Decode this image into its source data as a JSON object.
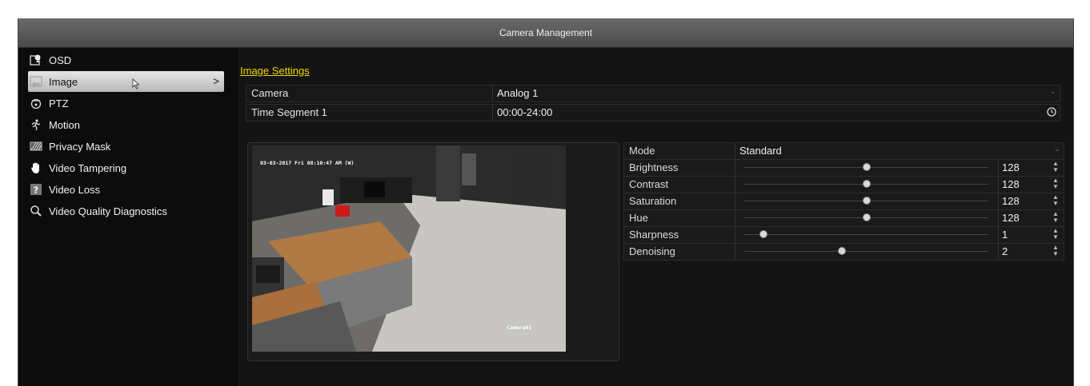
{
  "window": {
    "title": "Camera Management"
  },
  "sidebar": {
    "items": [
      {
        "label": "OSD",
        "icon": "osd-icon"
      },
      {
        "label": "Image",
        "icon": "image-icon",
        "active": true
      },
      {
        "label": "PTZ",
        "icon": "ptz-icon"
      },
      {
        "label": "Motion",
        "icon": "motion-icon"
      },
      {
        "label": "Privacy Mask",
        "icon": "privacy-mask-icon"
      },
      {
        "label": "Video Tampering",
        "icon": "hand-icon"
      },
      {
        "label": "Video Loss",
        "icon": "question-icon"
      },
      {
        "label": "Video Quality Diagnostics",
        "icon": "magnifier-icon"
      }
    ],
    "active_chevron": ">"
  },
  "main": {
    "section_title": "Image Settings",
    "camera": {
      "label": "Camera",
      "value": "Analog 1"
    },
    "time_segment": {
      "label": "Time Segment 1",
      "value": "00:00-24:00"
    },
    "preview": {
      "osd_timestamp": "03-03-2017 Fri 08:10:47 AM (W)",
      "osd_camera_name": "Camera01"
    },
    "mode": {
      "label": "Mode",
      "value": "Standard"
    },
    "params": [
      {
        "label": "Brightness",
        "value": "128",
        "level": 0.5
      },
      {
        "label": "Contrast",
        "value": "128",
        "level": 0.5
      },
      {
        "label": "Saturation",
        "value": "128",
        "level": 0.5
      },
      {
        "label": "Hue",
        "value": "128",
        "level": 0.5
      },
      {
        "label": "Sharpness",
        "value": "1",
        "level": 0.08
      },
      {
        "label": "Denoising",
        "value": "2",
        "level": 0.4
      }
    ]
  },
  "colors": {
    "accent": "#f5d800",
    "active_item": "#d0d0d0",
    "background": "#141414"
  }
}
